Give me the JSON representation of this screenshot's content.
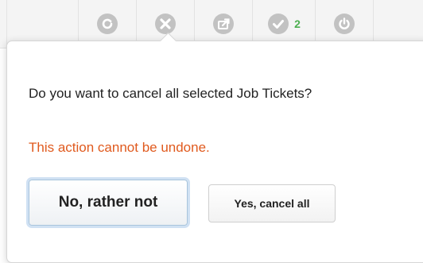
{
  "toolbar": {
    "buttons": [
      {
        "icon": "refresh-icon"
      },
      {
        "icon": "cancel-icon"
      },
      {
        "icon": "export-icon"
      },
      {
        "icon": "check-icon",
        "count": "2"
      },
      {
        "icon": "power-icon"
      }
    ],
    "icon_color": "#c2c2c2",
    "count_color": "#4caf50"
  },
  "dialog": {
    "message": "Do you want to cancel all selected Job Tickets?",
    "warning": "This action cannot be undone.",
    "warning_color": "#e05a1e",
    "confirm_no_label": "No, rather not",
    "confirm_yes_label": "Yes, cancel all"
  }
}
